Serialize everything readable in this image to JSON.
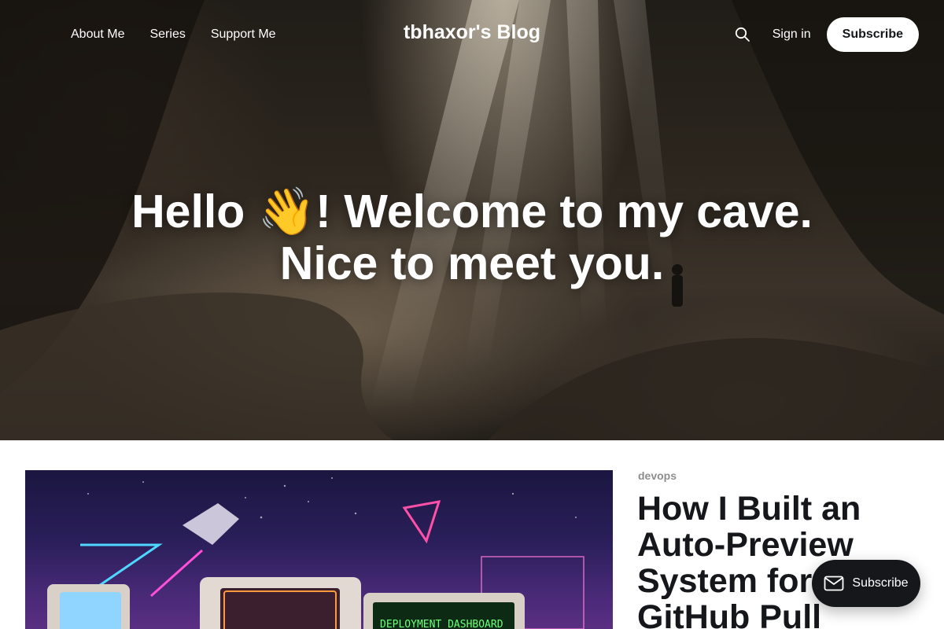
{
  "header": {
    "site_title": "tbhaxor's Blog",
    "nav_links": [
      {
        "label": "About Me"
      },
      {
        "label": "Series"
      },
      {
        "label": "Support Me"
      }
    ],
    "signin_label": "Sign in",
    "subscribe_label": "Subscribe"
  },
  "hero": {
    "headline_line1": "Hello 👋! Welcome to my cave.",
    "headline_line2": "Nice to meet you."
  },
  "featured_post": {
    "tag": "devops",
    "title": "How I Built an Auto-Preview System for GitHub Pull",
    "image_text": "DEPLOYMENT DASHBOARD"
  },
  "portal": {
    "subscribe_label": "Subscribe"
  },
  "colors": {
    "accent": "#15171a",
    "tag": "#8e8e8e"
  },
  "icons": {
    "search": "search-icon",
    "portal": "mail-icon"
  }
}
